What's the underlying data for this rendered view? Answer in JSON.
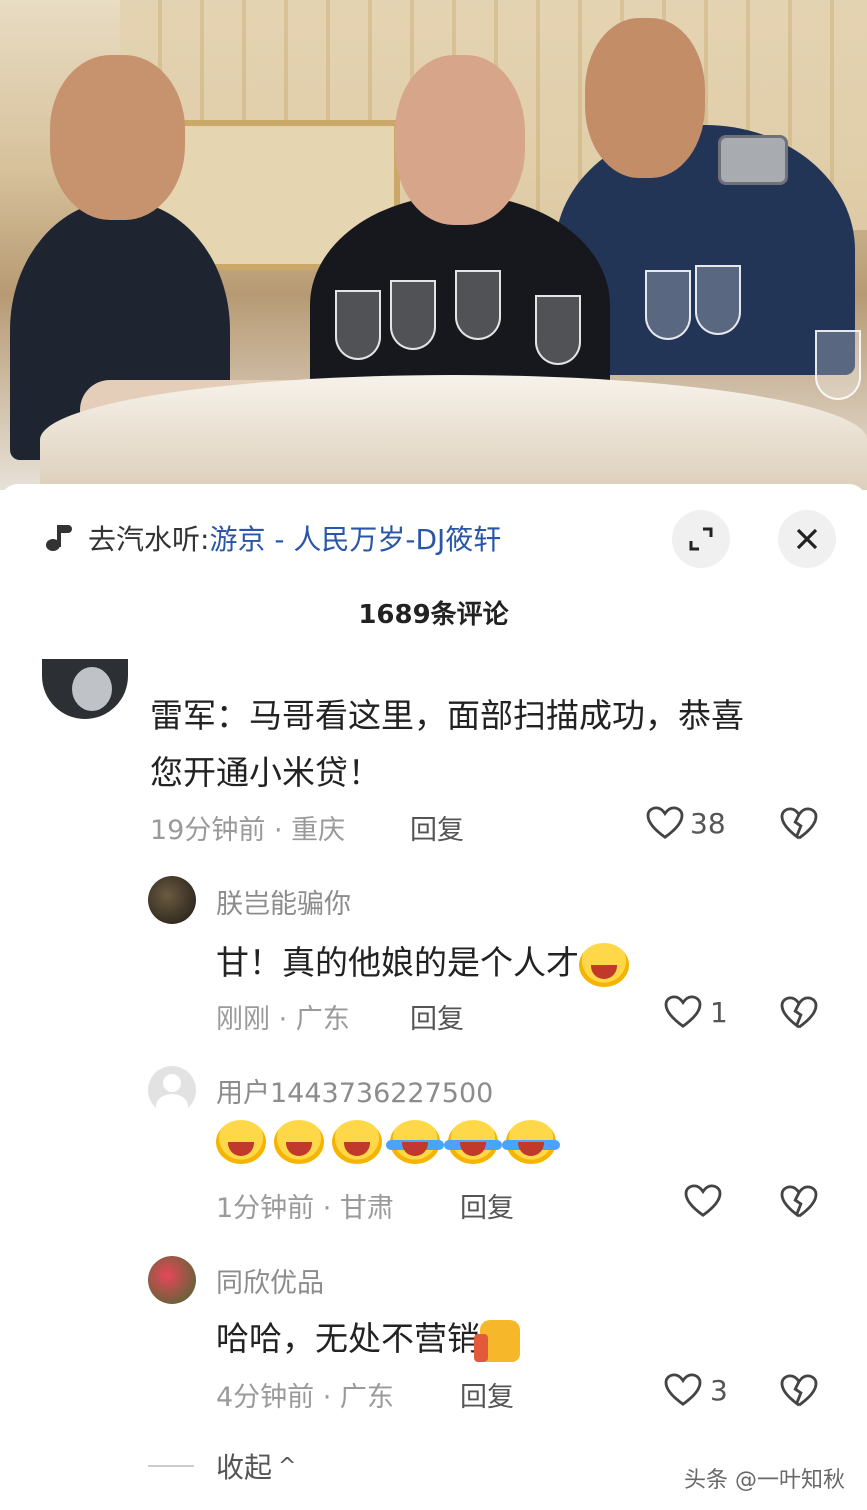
{
  "music": {
    "prefix": "去汽水听: ",
    "title": "游京 - 人民万岁-DJ筱轩",
    "icon": "music-note-icon"
  },
  "header": {
    "count_label": "1689条评论",
    "expand_icon": "expand-icon",
    "close_icon": "close-icon"
  },
  "comments": [
    {
      "text_line1": "雷军：马哥看这里，面部扫描成功，恭喜",
      "text_line2": "您开通小米贷！",
      "time_loc": "19分钟前 · 重庆",
      "reply": "回复",
      "likes": "38"
    },
    {
      "name": "朕岂能骗你",
      "text": "甘！真的他娘的是个人才",
      "time_loc": "刚刚 · 广东",
      "reply": "回复",
      "likes": "1"
    },
    {
      "name": "用户1443736227500",
      "text": "",
      "time_loc": "1分钟前 · 甘肃",
      "reply": "回复",
      "likes": ""
    },
    {
      "name": "同欣优品",
      "text": "哈哈，无处不营销",
      "time_loc": "4分钟前 · 广东",
      "reply": "回复",
      "likes": "3"
    }
  ],
  "collapse": {
    "label": "收起",
    "chevron": "^"
  },
  "watermark": "头条 @一叶知秋"
}
